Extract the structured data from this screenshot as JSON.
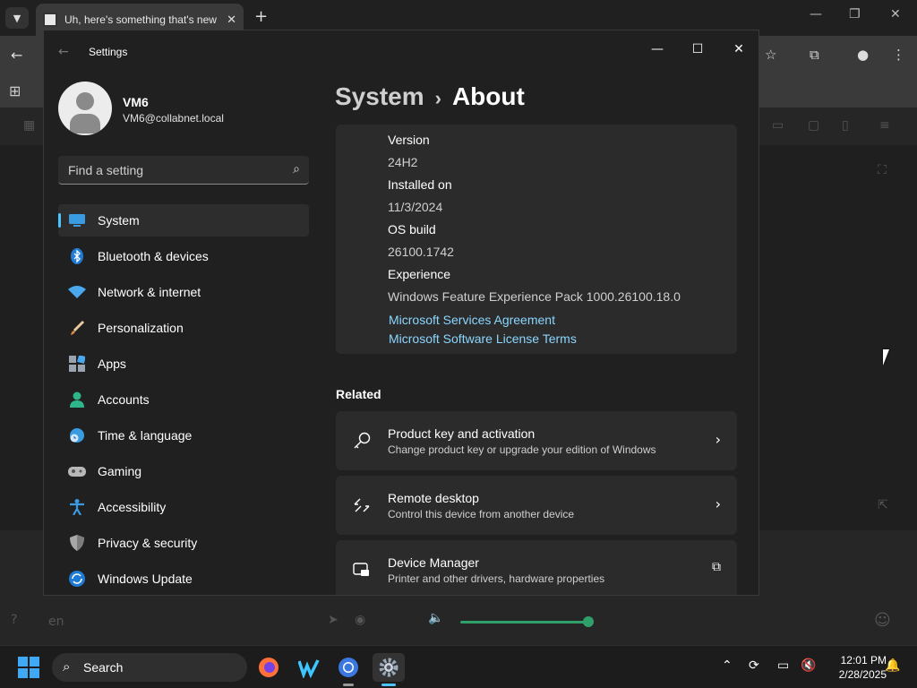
{
  "browser": {
    "tab_title": "Uh, here's something that's new",
    "new_tab_glyph": "+",
    "chat_input_text": "en"
  },
  "settings": {
    "window_title": "Settings",
    "profile": {
      "name": "VM6",
      "email": "VM6@collabnet.local"
    },
    "search": {
      "placeholder": "Find a setting"
    },
    "nav": [
      {
        "label": "System",
        "icon": "system-monitor-icon",
        "active": true
      },
      {
        "label": "Bluetooth & devices",
        "icon": "bluetooth-icon"
      },
      {
        "label": "Network & internet",
        "icon": "wifi-icon"
      },
      {
        "label": "Personalization",
        "icon": "paintbrush-icon"
      },
      {
        "label": "Apps",
        "icon": "apps-icon"
      },
      {
        "label": "Accounts",
        "icon": "person-icon"
      },
      {
        "label": "Time & language",
        "icon": "globe-clock-icon"
      },
      {
        "label": "Gaming",
        "icon": "gamepad-icon"
      },
      {
        "label": "Accessibility",
        "icon": "accessibility-icon"
      },
      {
        "label": "Privacy & security",
        "icon": "shield-icon"
      },
      {
        "label": "Windows Update",
        "icon": "update-icon"
      }
    ],
    "breadcrumb": {
      "parent": "System",
      "separator": "›",
      "current": "About"
    },
    "specs": {
      "version_label": "Version",
      "version_value": "24H2",
      "installed_label": "Installed on",
      "installed_value": "11/3/2024",
      "os_build_label": "OS build",
      "os_build_value": "26100.1742",
      "experience_label": "Experience",
      "experience_value": "Windows Feature Experience Pack 1000.26100.18.0",
      "link_services": "Microsoft Services Agreement",
      "link_license": "Microsoft Software License Terms"
    },
    "related": {
      "heading": "Related",
      "items": [
        {
          "title": "Product key and activation",
          "desc": "Change product key or upgrade your edition of Windows",
          "icon": "key-icon",
          "action": "chevron-right-icon"
        },
        {
          "title": "Remote desktop",
          "desc": "Control this device from another device",
          "icon": "remote-desktop-icon",
          "action": "chevron-right-icon"
        },
        {
          "title": "Device Manager",
          "desc": "Printer and other drivers, hardware properties",
          "icon": "device-manager-icon",
          "action": "external-link-icon"
        }
      ]
    }
  },
  "taskbar": {
    "search_label": "Search",
    "time": "12:01 PM",
    "date": "2/28/2025"
  },
  "colors": {
    "accent": "#4cc2ff",
    "link": "#8ad6ff",
    "window_bg": "#202020",
    "card_bg": "#2b2b2b"
  }
}
